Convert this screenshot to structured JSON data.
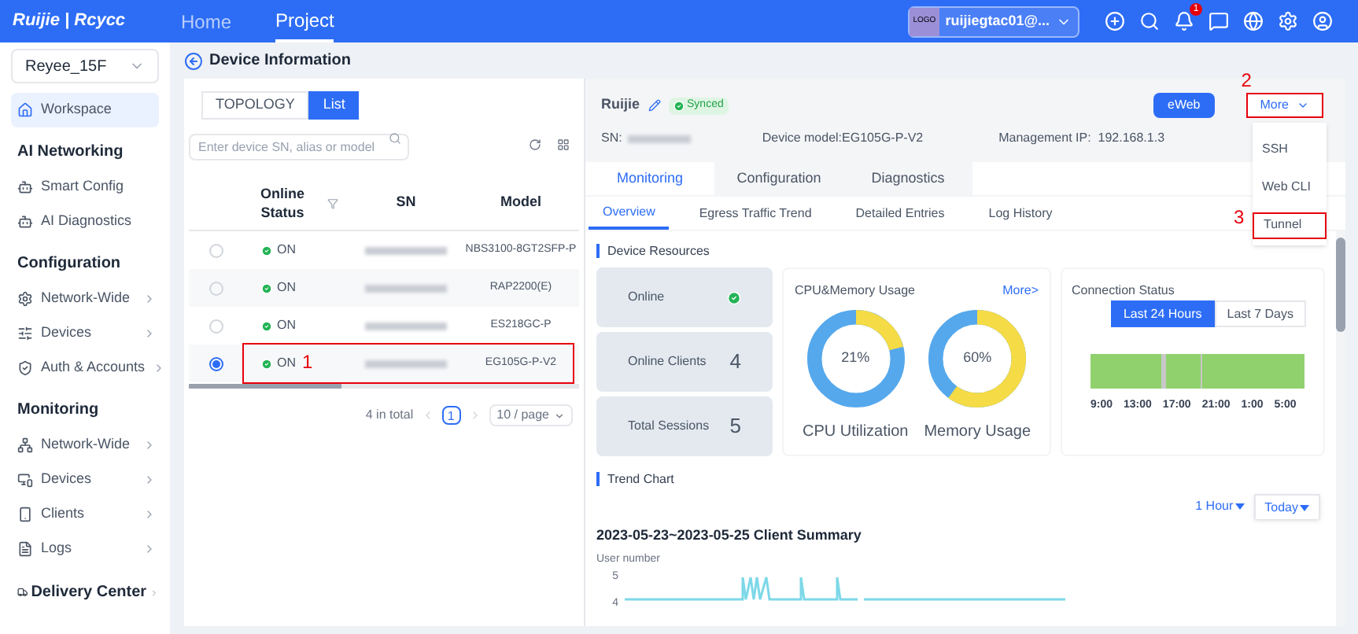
{
  "top_bar": {
    "logo": "Ruijie | Rcycc",
    "nav": [
      {
        "label": "Home",
        "selected": false
      },
      {
        "label": "Project",
        "selected": true
      }
    ],
    "account": {
      "logo": "LOGO",
      "name": "ruijiegtac01@..."
    },
    "notification_badge": "1"
  },
  "sidebar": {
    "project": "Reyee_15F",
    "sections": [
      {
        "kind": "item",
        "label": "Workspace",
        "selected": true,
        "has_arrow": false
      },
      {
        "kind": "heading",
        "label": "AI Networking"
      },
      {
        "kind": "item",
        "label": "Smart Config",
        "selected": false,
        "has_arrow": false
      },
      {
        "kind": "item",
        "label": "AI Diagnostics",
        "selected": false,
        "has_arrow": false
      },
      {
        "kind": "heading",
        "label": "Configuration"
      },
      {
        "kind": "item",
        "label": "Network-Wide",
        "selected": false,
        "has_arrow": true
      },
      {
        "kind": "item",
        "label": "Devices",
        "selected": false,
        "has_arrow": true
      },
      {
        "kind": "item",
        "label": "Auth & Accounts",
        "selected": false,
        "has_arrow": true
      },
      {
        "kind": "heading",
        "label": "Monitoring"
      },
      {
        "kind": "item",
        "label": "Network-Wide",
        "selected": false,
        "has_arrow": true
      },
      {
        "kind": "item",
        "label": "Devices",
        "selected": false,
        "has_arrow": true
      },
      {
        "kind": "item",
        "label": "Clients",
        "selected": false,
        "has_arrow": true
      },
      {
        "kind": "item",
        "label": "Logs",
        "selected": false,
        "has_arrow": true
      },
      {
        "kind": "heading_link",
        "label": "Delivery Center"
      }
    ]
  },
  "page_title": "Device Information",
  "device_list": {
    "view_toggle": [
      {
        "label": "TOPOLOGY",
        "selected": false
      },
      {
        "label": "List",
        "selected": true
      }
    ],
    "search": {
      "placeholder": "Enter device SN, alias or model"
    },
    "columns": [
      "Online Status",
      "SN",
      "Model"
    ],
    "rows": [
      {
        "selected": false,
        "status": "ON",
        "model": "NBS3100-8GT2SFP-P"
      },
      {
        "selected": false,
        "status": "ON",
        "model": "RAP2200(E)"
      },
      {
        "selected": false,
        "status": "ON",
        "model": "ES218GC-P"
      },
      {
        "selected": true,
        "status": "ON",
        "model": "EG105G-P-V2"
      }
    ],
    "pagination": {
      "total": "4 in total",
      "page": "1",
      "page_size": "10 / page"
    }
  },
  "device": {
    "name": "Ruijie",
    "sync_status": "Synced",
    "sn_label": "SN:",
    "model": "Device model:EG105G-P-V2",
    "ip": "Management IP:  192.168.1.3",
    "buttons": [
      "eWeb",
      "More"
    ],
    "more_menu": [
      {
        "label": "SSH",
        "highlighted": false
      },
      {
        "label": "Web CLI",
        "highlighted": false
      },
      {
        "label": "Tunnel",
        "highlighted": true
      }
    ],
    "tabs": [
      {
        "label": "Monitoring",
        "selected": true
      },
      {
        "label": "Configuration",
        "selected": false
      },
      {
        "label": "Diagnostics",
        "selected": false
      }
    ],
    "sub_tabs": [
      {
        "label": "Overview",
        "selected": true
      },
      {
        "label": "Egress Traffic Trend",
        "selected": false
      },
      {
        "label": "Detailed Entries",
        "selected": false
      },
      {
        "label": "Log History",
        "selected": false
      }
    ],
    "resources_title": "Device Resources",
    "stats": [
      {
        "kind": "status",
        "label": "Online"
      },
      {
        "kind": "count",
        "label": "Online Clients",
        "value": "4"
      },
      {
        "kind": "count",
        "label": "Total Sessions",
        "value": "5"
      }
    ],
    "usage": {
      "title": "CPU&Memory Usage",
      "link": "More>",
      "gauges": [
        {
          "reading": "21%",
          "level": 0.21,
          "label": "CPU Utilization"
        },
        {
          "reading": "60%",
          "level": 0.6,
          "label": "Memory Usage"
        }
      ]
    },
    "connection": {
      "title": "Connection Status",
      "ranges": [
        {
          "label": "Last 24 Hours",
          "selected": true
        },
        {
          "label": "Last 7 Days",
          "selected": false
        }
      ],
      "times": [
        "9:00",
        "13:00",
        "17:00",
        "21:00",
        "1:00",
        "5:00"
      ]
    },
    "trend": {
      "title": "Trend Chart",
      "interval": "1 Hour",
      "day": "Today",
      "chart_title": "2023-05-23~2023-05-25 Client Summary",
      "ylabel": "User number",
      "y_ticks": [
        "5",
        "4"
      ]
    }
  },
  "annotations": [
    "1",
    "2",
    "3"
  ]
}
